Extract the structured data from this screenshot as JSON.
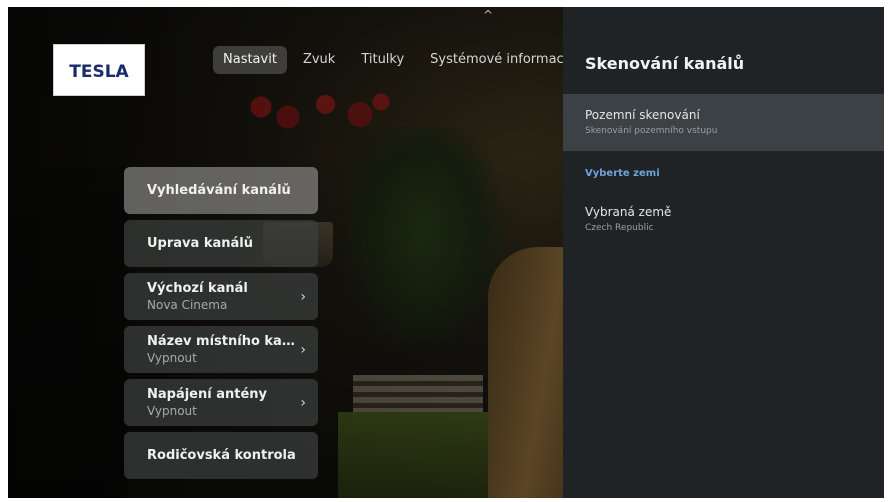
{
  "logo": {
    "text": "TESLA"
  },
  "nav": {
    "tabs": [
      {
        "label": "Nastavit",
        "active": true
      },
      {
        "label": "Zvuk",
        "active": false
      },
      {
        "label": "Titulky",
        "active": false
      },
      {
        "label": "Systémové informac",
        "active": false
      }
    ]
  },
  "menu": {
    "items": [
      {
        "label": "Vyhledávání kanálů",
        "value": "",
        "focused": true
      },
      {
        "label": "Úprava kanálů",
        "value": ""
      },
      {
        "label": "Výchozí kanál",
        "value": "Nova Cinema",
        "has_arrow": true
      },
      {
        "label": "Název místního kaná..",
        "value": "Vypnout",
        "has_arrow": true
      },
      {
        "label": "Napájení antény",
        "value": "Vypnout",
        "has_arrow": true
      },
      {
        "label": "Rodičovská kontrola",
        "value": ""
      }
    ]
  },
  "panel": {
    "title": "Skenování kanálů",
    "items": [
      {
        "title": "Pozemní skenování",
        "subtitle": "Skenování pozemního vstupu",
        "selected": true
      }
    ],
    "section_header": "Vyberte zemi",
    "country": {
      "title": "Vybraná země",
      "subtitle": "Czech Republic"
    }
  },
  "colors": {
    "panel_bg": "#1f2325",
    "panel_selected": "#3b4144",
    "accent": "#6fa3d9",
    "logo_text": "#1a2a6c"
  },
  "icons": {
    "chevron_right": "›",
    "chevron_up": "^"
  }
}
